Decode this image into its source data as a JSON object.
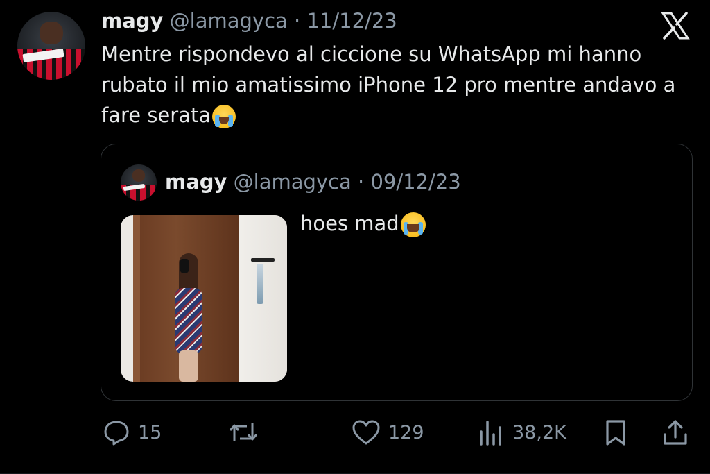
{
  "tweet": {
    "author_name": "magy",
    "handle": "@lamagyca",
    "separator": "·",
    "date": "11/12/23",
    "text": "Mentre rispondevo al ciccione su WhatsApp mi hanno rubato il mio amatissimo iPhone 12 pro mentre andavo a fare serata",
    "text_emoji": "loudly-crying-face"
  },
  "quoted": {
    "author_name": "magy",
    "handle": "@lamagyca",
    "separator": "·",
    "date": "09/12/23",
    "text": "hoes mad",
    "text_emoji": "face-with-tears-of-joy"
  },
  "actions": {
    "replies": "15",
    "reposts": "",
    "likes": "129",
    "views": "38,2K"
  },
  "colors": {
    "background": "#000000",
    "primary_text": "#e7e9ea",
    "secondary_text": "#8b98a5",
    "border": "#2f3336"
  },
  "icons": [
    "x-logo",
    "reply-icon",
    "repost-icon",
    "like-icon",
    "views-icon",
    "bookmark-icon",
    "share-icon"
  ]
}
